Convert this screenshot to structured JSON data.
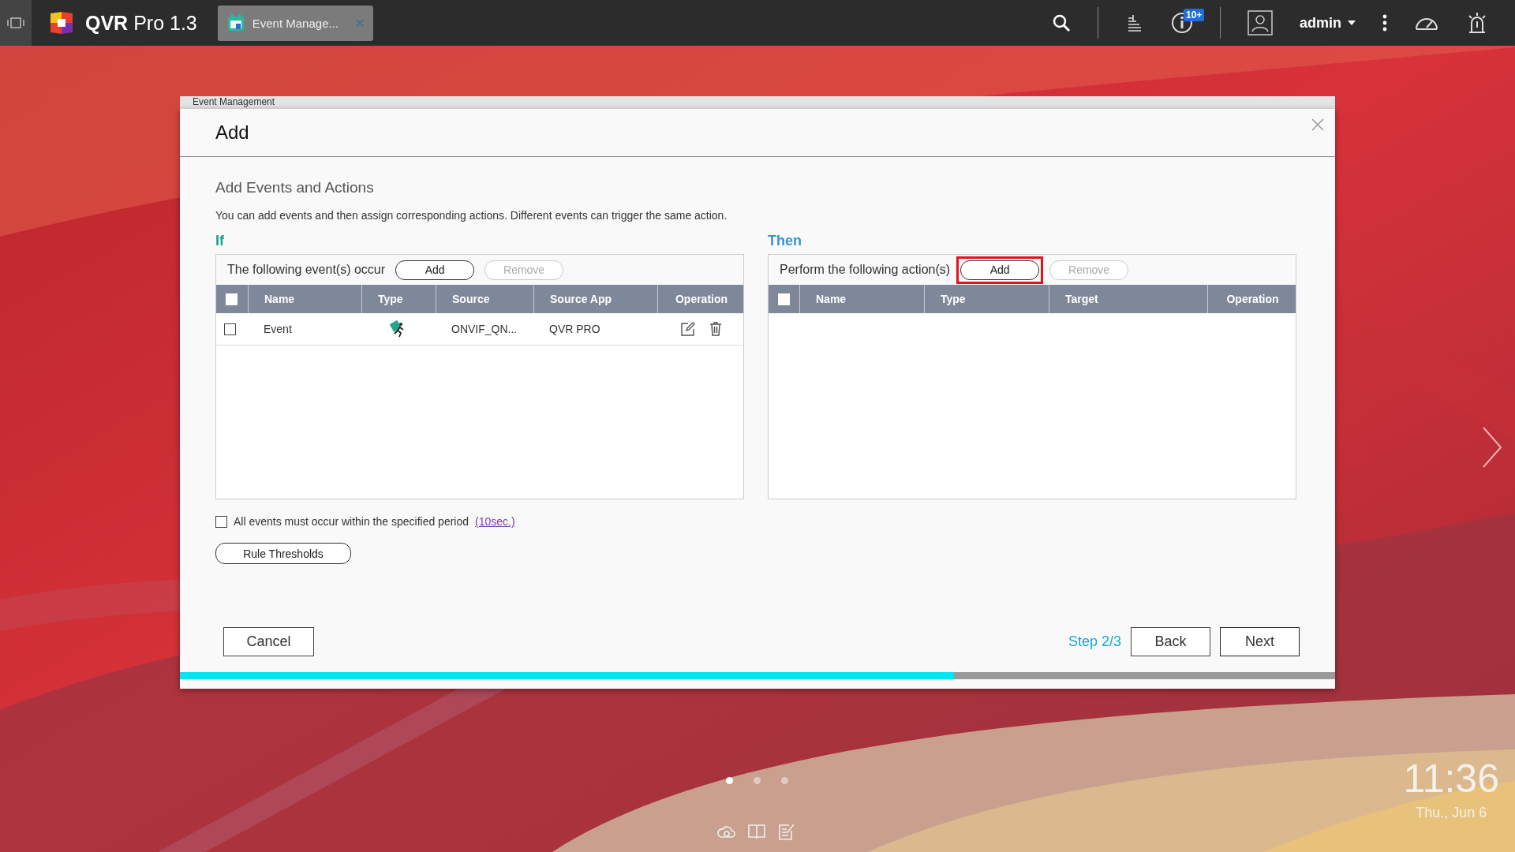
{
  "taskbar": {
    "app_name": "QVR",
    "app_version": "Pro 1.3",
    "tabs": [
      {
        "label": "Event Manage...",
        "selected": true
      }
    ],
    "notification_badge": "10+",
    "user": "admin"
  },
  "background_window": {
    "title": "Event Management"
  },
  "dialog": {
    "title": "Add",
    "heading": "Add Events and Actions",
    "description": "You can add events and then assign corresponding actions. Different events can trigger the same action.",
    "if_label": "If",
    "then_label": "Then",
    "events_panel": {
      "caption": "The following event(s) occur",
      "add_button": "Add",
      "remove_button": "Remove",
      "remove_disabled": true,
      "add_highlighted": false,
      "header_checked": false,
      "columns": [
        "Name",
        "Type",
        "Source",
        "Source App",
        "Operation"
      ],
      "rows": [
        {
          "checked": false,
          "name": "Event",
          "source": "ONVIF_QN...",
          "source_app": "QVR PRO"
        }
      ]
    },
    "actions_panel": {
      "caption": "Perform the following action(s)",
      "add_button": "Add",
      "remove_button": "Remove",
      "remove_disabled": true,
      "add_highlighted": true,
      "header_checked": false,
      "columns": [
        "Name",
        "Type",
        "Target",
        "Operation"
      ]
    },
    "period": {
      "checked": false,
      "text": "All events must occur within the specified period",
      "link": "(10sec.)"
    },
    "rule_button": "Rule Thresholds",
    "cancel_button": "Cancel",
    "step": "Step 2/3",
    "back_button": "Back",
    "next_button": "Next",
    "progress": {
      "level": 0.67
    }
  },
  "page_dots": [
    {
      "selected": true
    },
    {
      "selected": false
    },
    {
      "selected": false
    }
  ],
  "clock": {
    "time": "11:36",
    "date": "Thu., Jun 6"
  }
}
